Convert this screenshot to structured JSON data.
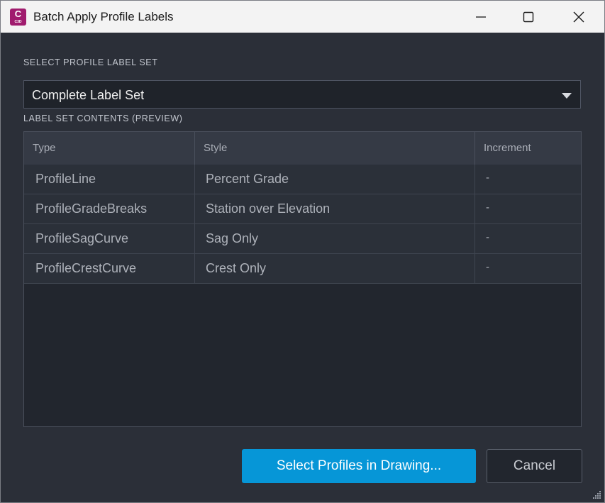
{
  "window": {
    "title": "Batch Apply Profile Labels",
    "app_icon": {
      "letter": "C",
      "sub": "C3D",
      "color": "#a01c6e"
    }
  },
  "label_set": {
    "section_label": "SELECT PROFILE LABEL SET",
    "selected": "Complete Label Set"
  },
  "preview": {
    "section_label": "LABEL SET CONTENTS (PREVIEW)",
    "columns": [
      "Type",
      "Style",
      "Increment"
    ],
    "rows": [
      {
        "type": "ProfileLine",
        "style": "Percent Grade",
        "increment": "-"
      },
      {
        "type": "ProfileGradeBreaks",
        "style": "Station over Elevation",
        "increment": "-"
      },
      {
        "type": "ProfileSagCurve",
        "style": "Sag Only",
        "increment": "-"
      },
      {
        "type": "ProfileCrestCurve",
        "style": "Crest Only",
        "increment": "-"
      }
    ]
  },
  "actions": {
    "primary_label": "Select Profiles in Drawing...",
    "cancel_label": "Cancel"
  },
  "colors": {
    "accent": "#0696d7",
    "background": "#2b2f38",
    "titlebar": "#f3f3f3"
  }
}
